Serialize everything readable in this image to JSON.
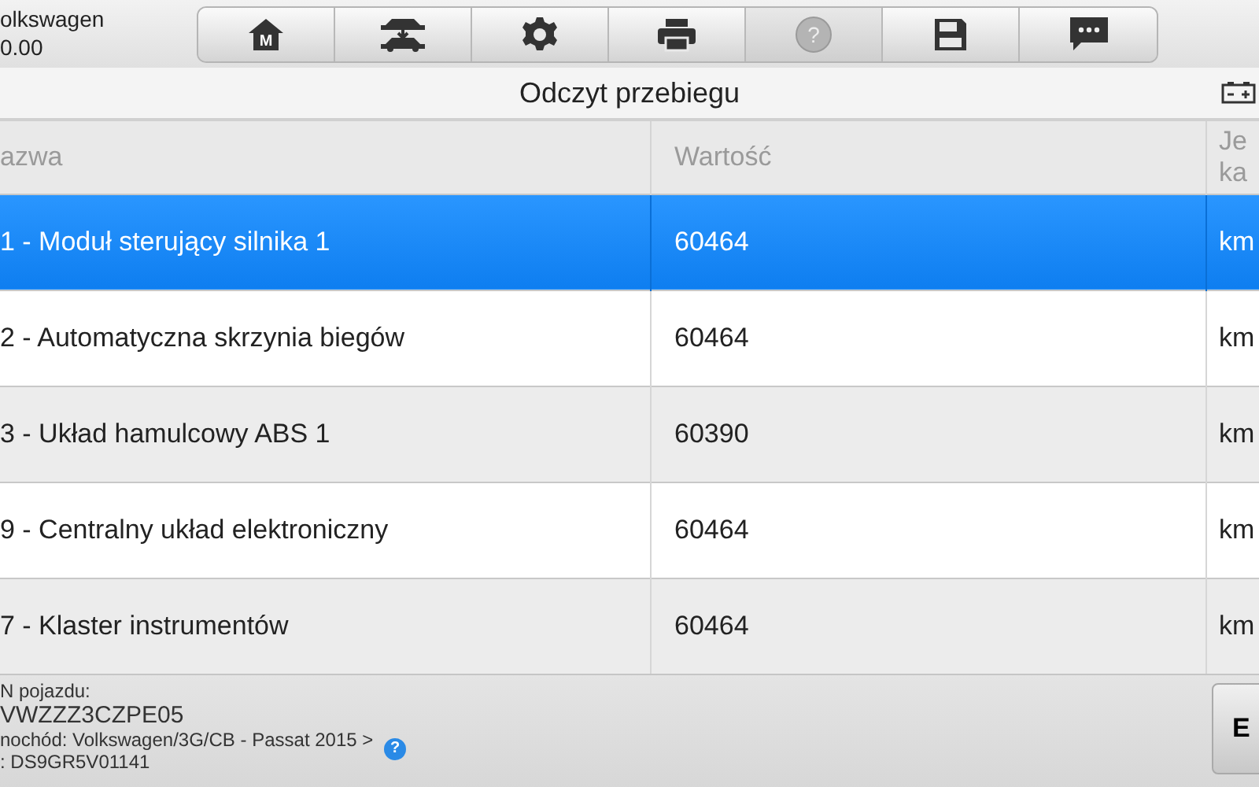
{
  "header": {
    "make": "olkswagen",
    "value": "0.00"
  },
  "toolbar": [
    {
      "kind": "home",
      "glyph": "M",
      "disabled": false
    },
    {
      "kind": "lift",
      "disabled": false
    },
    {
      "kind": "gear",
      "disabled": false
    },
    {
      "kind": "printer",
      "disabled": false
    },
    {
      "kind": "help",
      "glyph": "?",
      "disabled": true
    },
    {
      "kind": "save",
      "disabled": false
    },
    {
      "kind": "chat",
      "disabled": false
    }
  ],
  "title": "Odczyt przebiegu",
  "table": {
    "columns": [
      "azwa",
      "Wartość",
      "Je\nka"
    ],
    "rows": [
      {
        "cells": [
          "1 - Moduł sterujący silnika 1",
          "60464",
          "km"
        ],
        "selected": true
      },
      {
        "cells": [
          "2 - Automatyczna skrzynia biegów",
          "60464",
          "km"
        ],
        "selected": false
      },
      {
        "cells": [
          "3 - Układ hamulcowy ABS 1",
          "60390",
          "km"
        ],
        "selected": false
      },
      {
        "cells": [
          "9 - Centralny układ elektroniczny",
          "60464",
          "km"
        ],
        "selected": false
      },
      {
        "cells": [
          "7 - Klaster instrumentów",
          "60464",
          "km"
        ],
        "selected": false
      }
    ]
  },
  "footer": {
    "lines": [
      "N pojazdu:",
      "VWZZZ3CZPE05",
      "nochód: Volkswagen/3G/CB - Passat 2015 >",
      ": DS9GR5V01141"
    ],
    "help_glyph": "?",
    "button": "E"
  }
}
